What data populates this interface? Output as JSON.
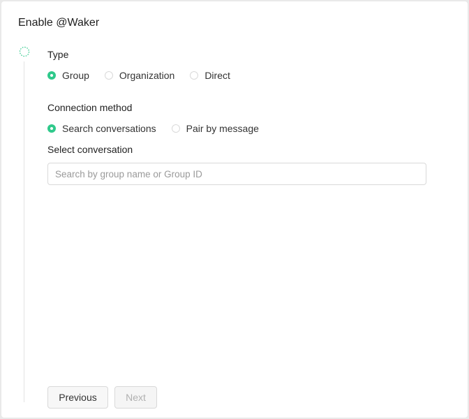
{
  "dialog": {
    "title": "Enable @Waker"
  },
  "step": {
    "icon": "loading-spinner-icon",
    "accent_color": "#2fc98b"
  },
  "type_section": {
    "label": "Type",
    "options": [
      {
        "label": "Group",
        "checked": true
      },
      {
        "label": "Organization",
        "checked": false
      },
      {
        "label": "Direct",
        "checked": false
      }
    ]
  },
  "connection_section": {
    "label": "Connection method",
    "options": [
      {
        "label": "Search conversations",
        "checked": true
      },
      {
        "label": "Pair by message",
        "checked": false
      }
    ]
  },
  "conversation_section": {
    "label": "Select conversation",
    "search_value": "",
    "search_placeholder": "Search by group name or Group ID"
  },
  "footer": {
    "previous_label": "Previous",
    "next_label": "Next",
    "next_disabled": true
  }
}
